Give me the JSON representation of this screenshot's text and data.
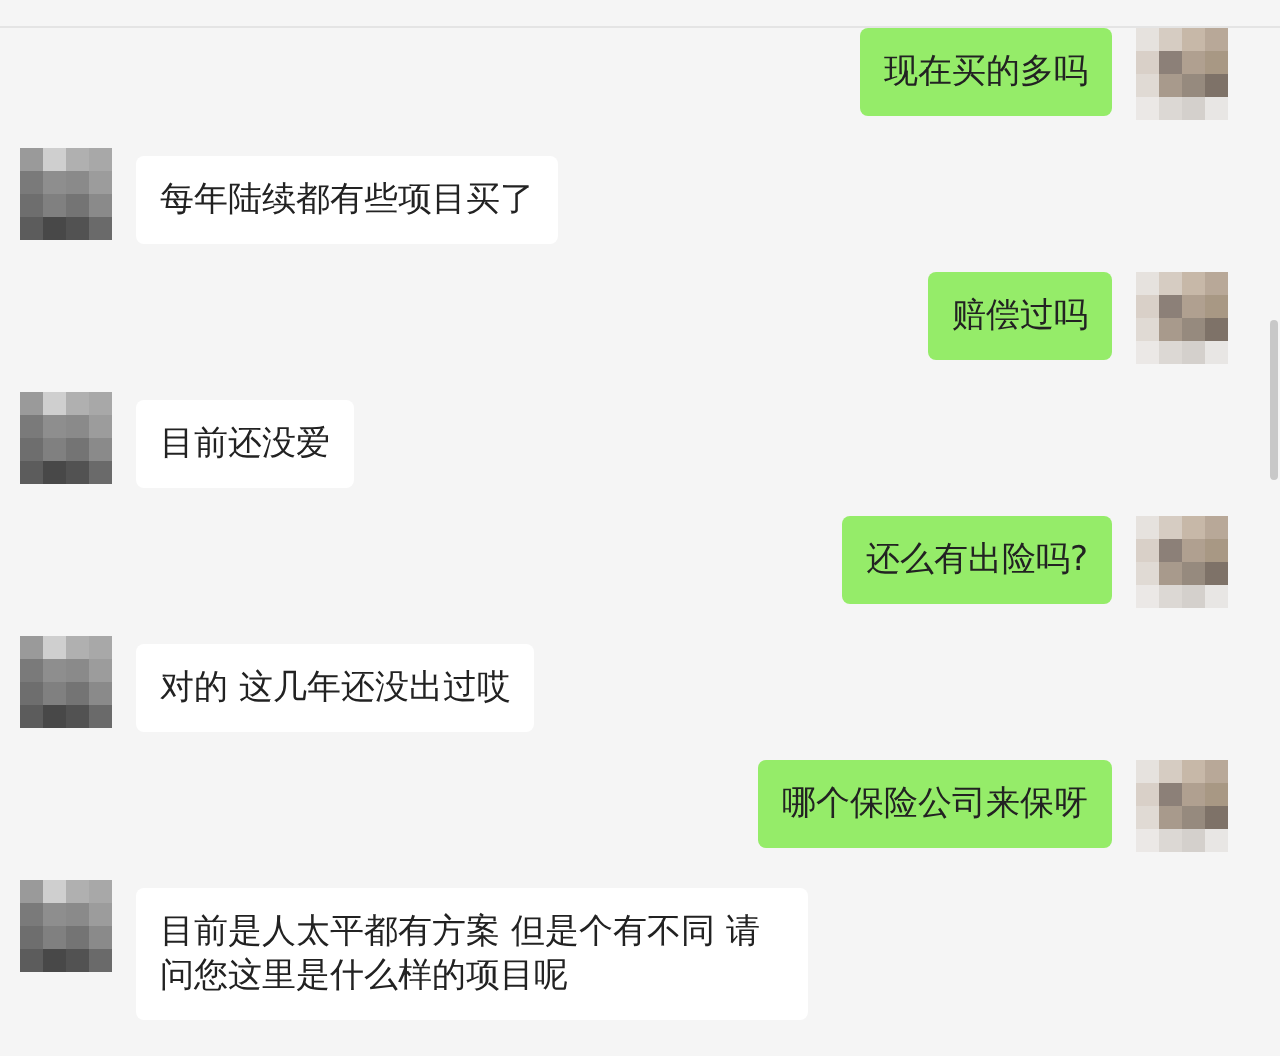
{
  "messages": [
    {
      "kind": "sent",
      "text": "现在买的多吗"
    },
    {
      "kind": "received",
      "text": "每年陆续都有些项目买了"
    },
    {
      "kind": "sent",
      "text": "赔偿过吗"
    },
    {
      "kind": "received",
      "text": "目前还没爱"
    },
    {
      "kind": "sent",
      "text": "还么有出险吗?"
    },
    {
      "kind": "received",
      "text": "对的 这几年还没出过哎"
    },
    {
      "kind": "sent",
      "text": "哪个保险公司来保呀"
    },
    {
      "kind": "received",
      "text": "目前是人太平都有方案 但是个有不同 请问您这里是什么样的项目呢"
    }
  ]
}
